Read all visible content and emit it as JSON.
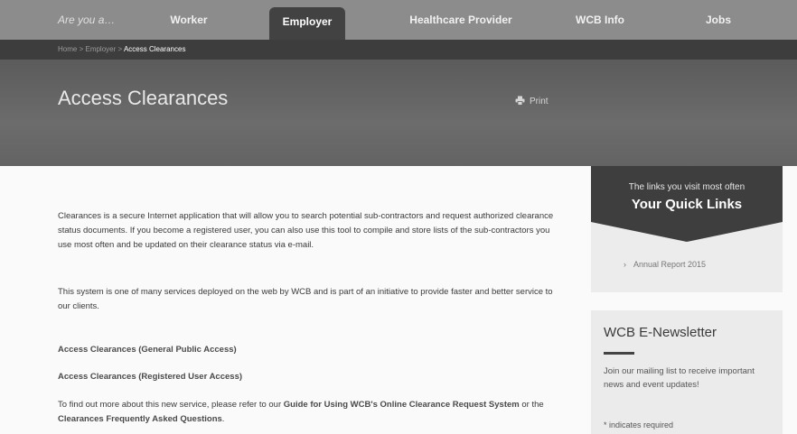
{
  "nav": {
    "prompt": "Are you a…",
    "items": [
      {
        "label": "Worker"
      },
      {
        "label": "Employer"
      },
      {
        "label": "Healthcare Provider"
      },
      {
        "label": "WCB Info"
      },
      {
        "label": "Jobs"
      }
    ],
    "active": "Employer"
  },
  "breadcrumb": {
    "home": "Home",
    "separator": ">",
    "parent": "Employer",
    "current": "Access Clearances"
  },
  "page": {
    "title": "Access Clearances",
    "print_label": "Print"
  },
  "content": {
    "paragraph1": "Clearances is a secure Internet application that will allow you to search potential sub-contractors and request authorized clearance status documents. If you become a registered user, you can also use this tool to compile and store lists of the sub-contractors you use most often and be updated on their clearance status via e-mail.",
    "paragraph2": "This system is one of many services deployed on the web by WCB and is part of an initiative to provide faster and better service to our clients.",
    "link_public": "Access Clearances (General Public Access)",
    "link_registered": "Access Clearances (Registered User Access)",
    "paragraph3_prefix": "To find out more about this new service, please refer to our ",
    "paragraph3_link1": "Guide for Using WCB's Online Clearance Request System",
    "paragraph3_mid": " or the ",
    "paragraph3_link2": "Clearances Frequently Asked Questions",
    "paragraph3_suffix": "."
  },
  "quick_links": {
    "subtitle": "The links you visit most often",
    "title": "Your Quick Links",
    "items": [
      {
        "label": "Annual Report 2015"
      }
    ]
  },
  "newsletter": {
    "title": "WCB E-Newsletter",
    "description": "Join our mailing list to receive important news and event updates!",
    "required_note": "* indicates required"
  },
  "colors": {
    "nav_bg": "#8c8c8c",
    "nav_active": "#424242",
    "breadcrumb_bg": "#3d3d3d",
    "hero_bg": "#636363",
    "sidebar_dark": "#3e3e3e"
  }
}
